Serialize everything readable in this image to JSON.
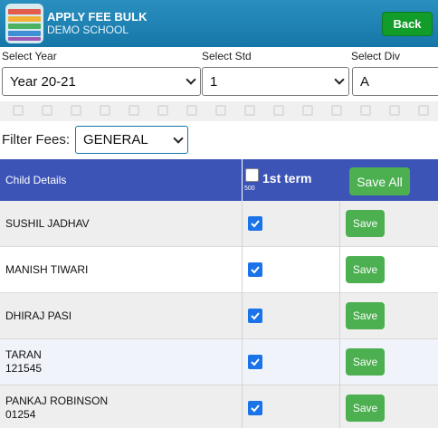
{
  "header": {
    "title": "APPLY FEE BULK",
    "subtitle": "DEMO SCHOOL",
    "back_label": "Back"
  },
  "selects": {
    "year": {
      "label": "Select Year",
      "value": "Year 20-21"
    },
    "std": {
      "label": "Select Std",
      "value": "1"
    },
    "div": {
      "label": "Select Div",
      "value": "A"
    }
  },
  "filter": {
    "label": "Filter Fees:",
    "value": "GENERAL"
  },
  "table": {
    "col_child": "Child Details",
    "term_label": "1st term",
    "term_amount": "500",
    "save_all_label": "Save All",
    "rows": [
      {
        "line1": "SUSHIL JADHAV",
        "line2": "",
        "checked": true,
        "save_label": "Save"
      },
      {
        "line1": "MANISH TIWARI",
        "line2": "",
        "checked": true,
        "save_label": "Save"
      },
      {
        "line1": "DHIRAJ PASI",
        "line2": "",
        "checked": true,
        "save_label": "Save"
      },
      {
        "line1": "TARAN",
        "line2": "121545",
        "checked": true,
        "save_label": "Save"
      },
      {
        "line1": "PANKAJ ROBINSON",
        "line2": "01254",
        "checked": true,
        "save_label": "Save"
      }
    ]
  },
  "colors": {
    "header": "#1577a8",
    "table_header": "#3d54b7",
    "save_green": "#4caf50",
    "back_green": "#129c2a",
    "checkbox_blue": "#1a73e8"
  }
}
